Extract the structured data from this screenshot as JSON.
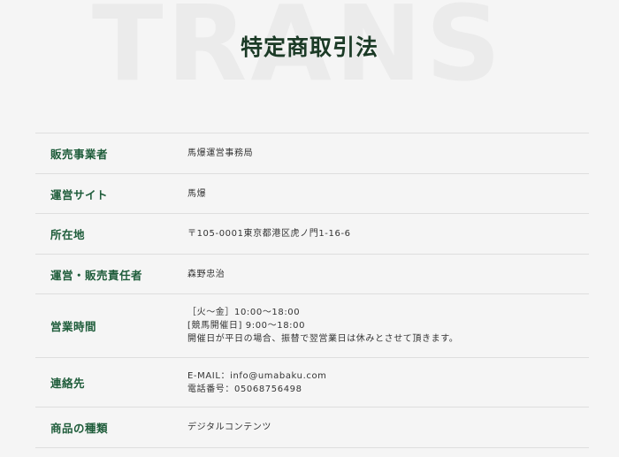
{
  "hero": {
    "background_word": "TRANS",
    "title": "特定商取引法"
  },
  "colors": {
    "label": "#1e5c3a",
    "title": "#1b3a26",
    "background": "#f5f5f5",
    "divider": "#dedede"
  },
  "rows": [
    {
      "label": "販売事業者",
      "lines": [
        "馬爆運営事務局"
      ]
    },
    {
      "label": "運営サイト",
      "lines": [
        "馬爆"
      ]
    },
    {
      "label": "所在地",
      "lines": [
        "〒105-0001東京都港区虎ノ門1-16-6"
      ]
    },
    {
      "label": "運営・販売責任者",
      "lines": [
        "森野忠治"
      ]
    },
    {
      "label": "営業時間",
      "lines": [
        "［火〜金］10:00〜18:00",
        "[競馬開催日] 9:00〜18:00",
        "開催日が平日の場合、振替で翌営業日は休みとさせて頂きます。"
      ]
    },
    {
      "label": "連絡先",
      "lines": [
        "E-MAIL：info@umabaku.com",
        "電話番号：05068756498"
      ]
    },
    {
      "label": "商品の種類",
      "lines": [
        "デジタルコンテンツ"
      ]
    }
  ]
}
